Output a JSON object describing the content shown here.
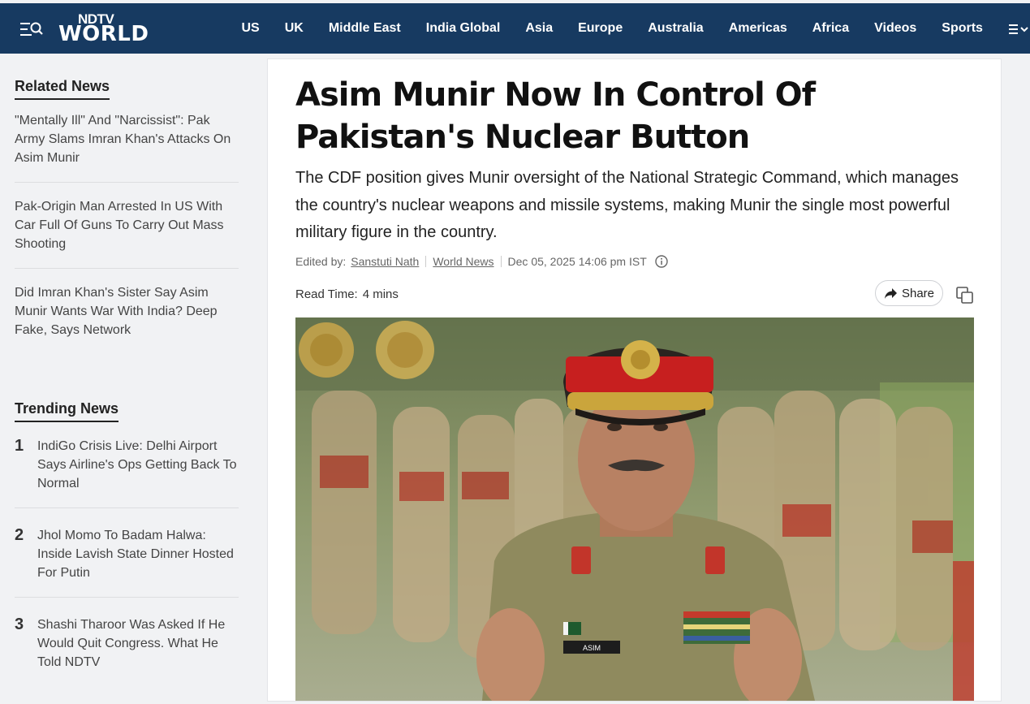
{
  "header": {
    "logo_top": "NDTV",
    "logo_bottom": "WORLD",
    "nav": [
      "US",
      "UK",
      "Middle East",
      "India Global",
      "Asia",
      "Europe",
      "Australia",
      "Americas",
      "Africa",
      "Videos",
      "Sports"
    ],
    "bg_color": "#173a61"
  },
  "related": {
    "heading": "Related News",
    "items": [
      "\"Mentally Ill\" And \"Narcissist\": Pak Army Slams Imran Khan's Attacks On Asim Munir",
      "Pak-Origin Man Arrested In US With Car Full Of Guns To Carry Out Mass Shooting",
      "Did Imran Khan's Sister Say Asim Munir Wants War With India? Deep Fake, Says Network"
    ]
  },
  "trending": {
    "heading": "Trending News",
    "items": [
      {
        "num": "1",
        "text": "IndiGo Crisis Live: Delhi Airport Says Airline's Ops Getting Back To Normal"
      },
      {
        "num": "2",
        "text": "Jhol Momo To Badam Halwa: Inside Lavish State Dinner Hosted For Putin"
      },
      {
        "num": "3",
        "text": "Shashi Tharoor Was Asked If He Would Quit Congress. What He Told NDTV"
      }
    ]
  },
  "article": {
    "headline": "Asim Munir Now In Control Of Pakistan's Nuclear Button",
    "summary": "The CDF position gives Munir oversight of the National Strategic Command, which manages the country's nuclear weapons and missile systems, making Munir the single most powerful military figure in the country.",
    "edited_by_label": "Edited by:",
    "editor": "Sanstuti Nath",
    "category": "World News",
    "date": "Dec 05, 2025 14:06 pm IST",
    "read_time_label": "Read Time:",
    "read_time_value": "4 mins",
    "share_label": "Share",
    "name_tag": "ASIM"
  }
}
